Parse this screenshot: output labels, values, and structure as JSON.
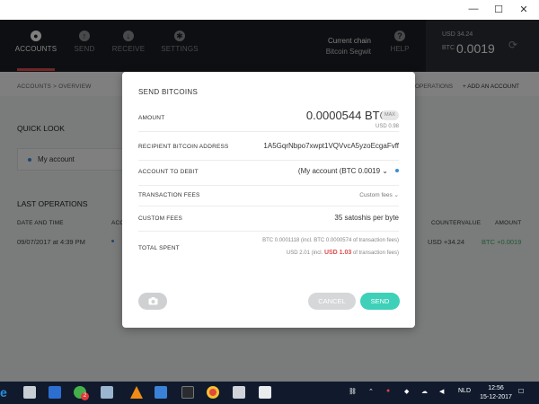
{
  "window": {
    "minimize": "—",
    "maximize": "☐",
    "close": "✕"
  },
  "nav": {
    "items": [
      {
        "label": "ACCOUNTS",
        "active": true
      },
      {
        "label": "SEND",
        "active": false
      },
      {
        "label": "RECEIVE",
        "active": false
      },
      {
        "label": "SETTINGS",
        "active": false
      }
    ],
    "current_chain_label": "Current chain",
    "current_chain_value": "Bitcoin Segwit",
    "help_label": "HELP"
  },
  "balance": {
    "usd": "USD 34.24",
    "btc_label": "BTC",
    "btc_value": "0.0019"
  },
  "page": {
    "breadcrumb": "ACCOUNTS  >  OVERVIEW",
    "operations_link": "OPERATIONS",
    "add_account": "+ ADD AN ACCOUNT",
    "quick_look_title": "QUICK LOOK",
    "account_name": "My account",
    "last_operations_title": "LAST OPERATIONS",
    "table_headers": {
      "date": "DATE AND TIME",
      "account": "ACCOUNT",
      "countervalue": "COUNTERVALUE",
      "amount": "AMOUNT"
    },
    "row": {
      "date": "09/07/2017 at 4:39 PM",
      "countervalue": "USD +34.24",
      "amount": "BTC +0.0019"
    }
  },
  "modal": {
    "title": "SEND BITCOINS",
    "amount_label": "AMOUNT",
    "amount_value": "0.0000544 BTC",
    "max_label": "MAX",
    "amount_usd": "USD 0.98",
    "recipient_label": "RECIPIENT BITCOIN ADDRESS",
    "recipient_value": "1A5GqrNbpo7xwpt1VQVvcA5yzoEcgaFvff",
    "account_label": "ACCOUNT TO DEBIT",
    "account_value": "(My account (BTC 0.0019 ⌄",
    "fees_label": "TRANSACTION FEES",
    "fees_value": "Custom fees ⌄",
    "custom_fees_label": "CUSTOM FEES",
    "custom_fees_value": "35 satoshis per byte",
    "total_label": "TOTAL SPENT",
    "total_btc": "BTC 0.0001118 (incl. BTC 0.0000574 of transaction fees)",
    "total_usd_prefix": "USD 2.01 (incl. ",
    "total_usd_fee": "USD 1.03",
    "total_usd_suffix": " of transaction fees)",
    "cancel_label": "CANCEL",
    "send_label": "SEND"
  },
  "taskbar": {
    "language": "NLD",
    "time": "12:56",
    "date": "15-12-2017",
    "badge_count": "2"
  }
}
